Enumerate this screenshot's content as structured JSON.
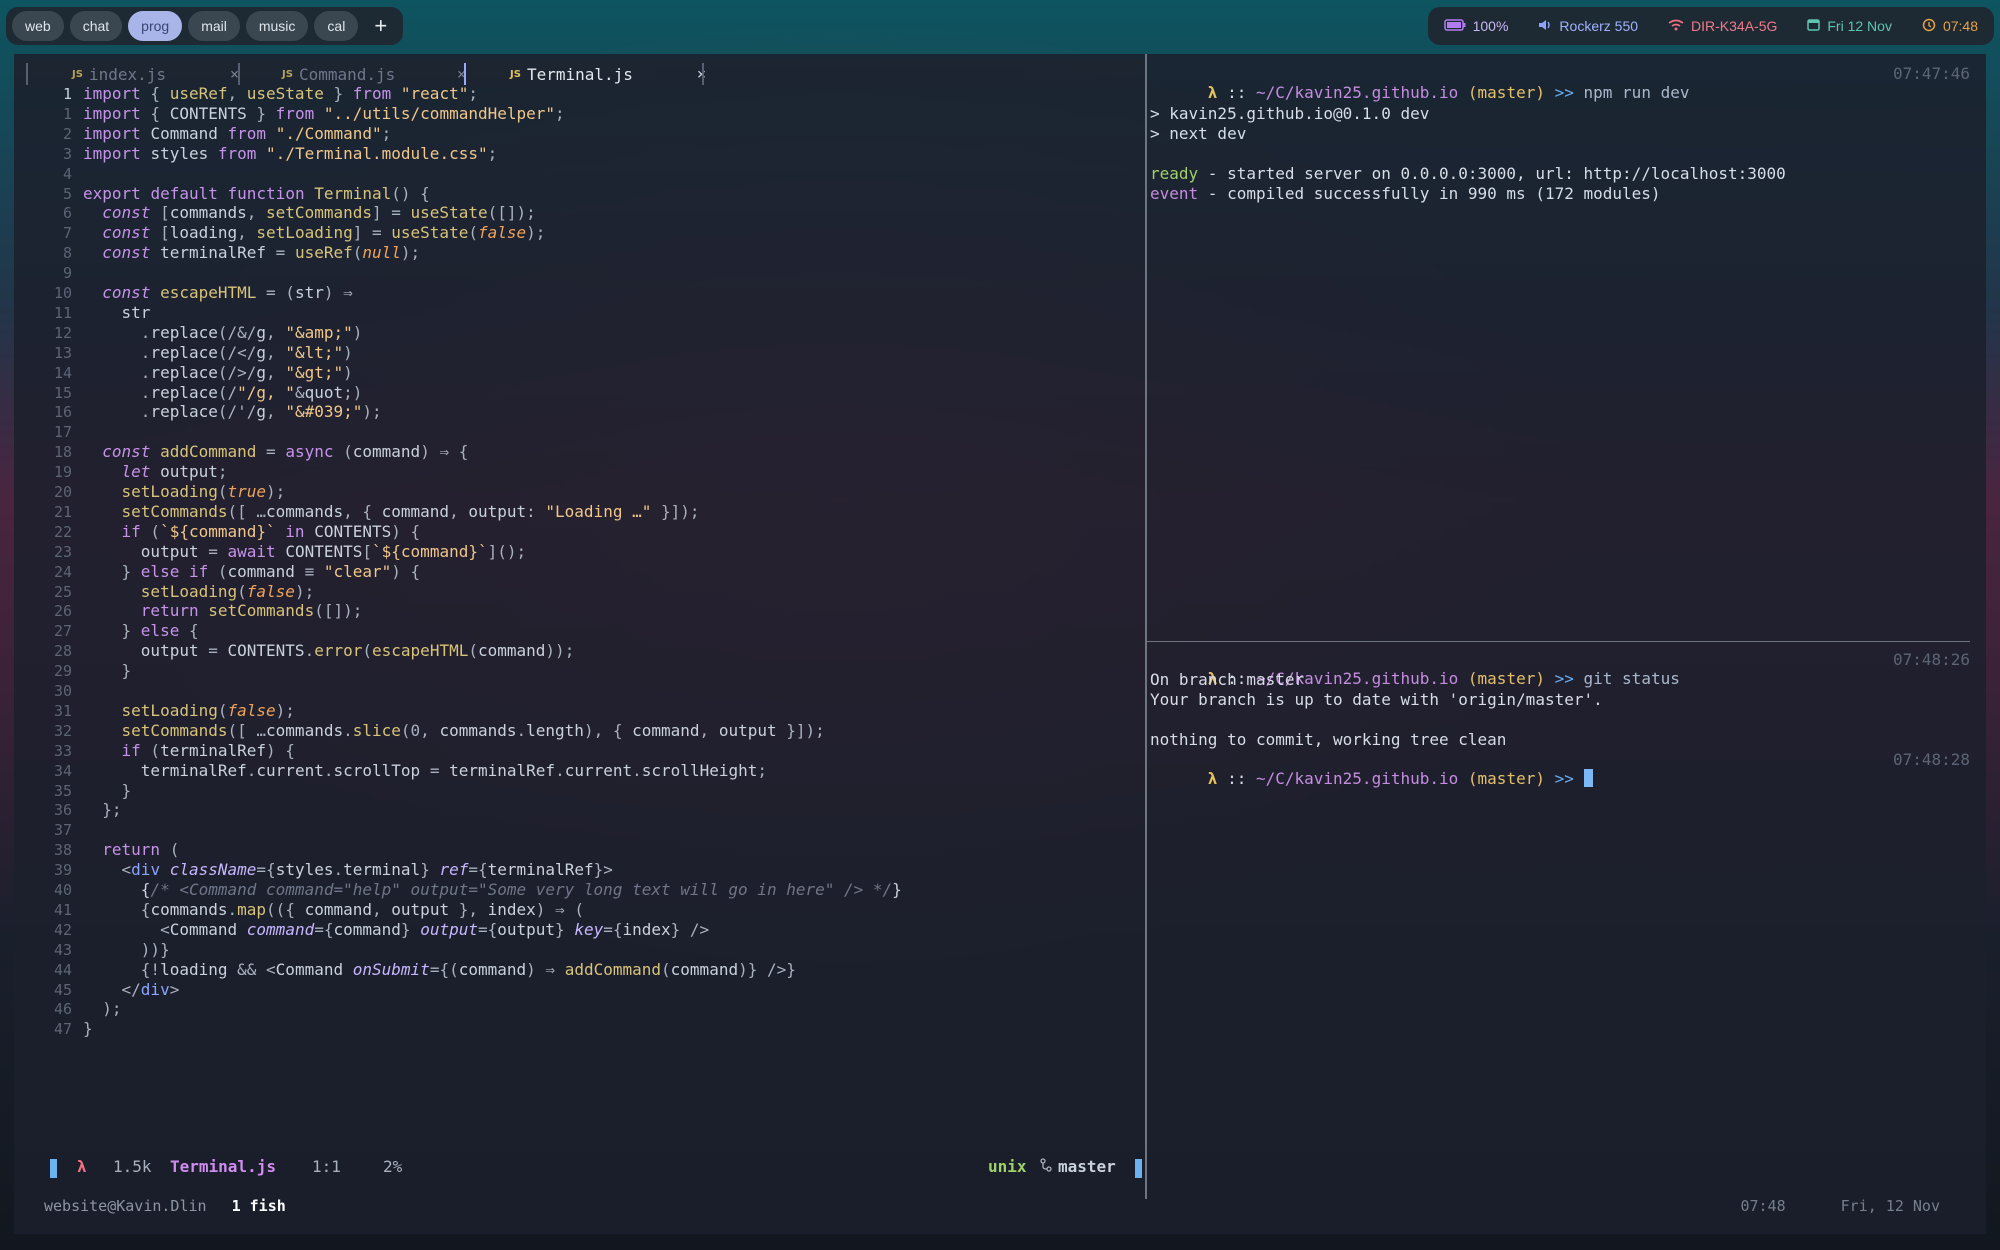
{
  "workspaces": [
    "web",
    "chat",
    "prog",
    "mail",
    "music",
    "cal"
  ],
  "workspace_add": "+",
  "status": {
    "battery": "100%",
    "audio": "Rockerz 550",
    "wifi": "DIR-K34A-5G",
    "date": "Fri 12 Nov",
    "time": "07:48"
  },
  "colors": {
    "accent": "#a9b4e8",
    "battery": "#b07cf0",
    "audio": "#8aa4ff",
    "wifi": "#f07080",
    "date": "#5fc4b0",
    "time": "#e6a24a"
  },
  "tabs": [
    {
      "icon": "JS",
      "name": "index.js",
      "close": "×"
    },
    {
      "icon": "JS",
      "name": "Command.js",
      "close": "×"
    },
    {
      "icon": "JS",
      "name": "Terminal.js",
      "close": "×"
    }
  ],
  "editor_lines": [
    {
      "n": "1",
      "t": "import { useRef, useState } from \"react\";"
    },
    {
      "n": "1",
      "t": "import { CONTENTS } from \"../utils/commandHelper\";"
    },
    {
      "n": "2",
      "t": "import Command from \"./Command\";"
    },
    {
      "n": "3",
      "t": "import styles from \"./Terminal.module.css\";"
    },
    {
      "n": "4",
      "t": ""
    },
    {
      "n": "5",
      "t": "export default function Terminal() {"
    },
    {
      "n": "6",
      "t": "  const [commands, setCommands] = useState([]);"
    },
    {
      "n": "7",
      "t": "  const [loading, setLoading] = useState(false);"
    },
    {
      "n": "8",
      "t": "  const terminalRef = useRef(null);"
    },
    {
      "n": "9",
      "t": ""
    },
    {
      "n": "10",
      "t": "  const escapeHTML = (str) ⇒"
    },
    {
      "n": "11",
      "t": "    str"
    },
    {
      "n": "12",
      "t": "      .replace(/&/g, \"&amp;\")"
    },
    {
      "n": "13",
      "t": "      .replace(/</g, \"&lt;\")"
    },
    {
      "n": "14",
      "t": "      .replace(/>/g, \"&gt;\")"
    },
    {
      "n": "15",
      "t": "      .replace(/\"/g, \"&quot;\")"
    },
    {
      "n": "16",
      "t": "      .replace(/'/g, \"&#039;\");"
    },
    {
      "n": "17",
      "t": ""
    },
    {
      "n": "18",
      "t": "  const addCommand = async (command) ⇒ {"
    },
    {
      "n": "19",
      "t": "    let output;"
    },
    {
      "n": "20",
      "t": "    setLoading(true);"
    },
    {
      "n": "21",
      "t": "    setCommands([ …commands, { command, output: \"Loading …\" }]);"
    },
    {
      "n": "22",
      "t": "    if (`${command}` in CONTENTS) {"
    },
    {
      "n": "23",
      "t": "      output = await CONTENTS[`${command}`]();"
    },
    {
      "n": "24",
      "t": "    } else if (command ≡ \"clear\") {"
    },
    {
      "n": "25",
      "t": "      setLoading(false);"
    },
    {
      "n": "26",
      "t": "      return setCommands([]);"
    },
    {
      "n": "27",
      "t": "    } else {"
    },
    {
      "n": "28",
      "t": "      output = CONTENTS.error(escapeHTML(command));"
    },
    {
      "n": "29",
      "t": "    }"
    },
    {
      "n": "30",
      "t": ""
    },
    {
      "n": "31",
      "t": "    setLoading(false);"
    },
    {
      "n": "32",
      "t": "    setCommands([ …commands.slice(0, commands.length), { command, output }]);"
    },
    {
      "n": "33",
      "t": "    if (terminalRef) {"
    },
    {
      "n": "34",
      "t": "      terminalRef.current.scrollTop = terminalRef.current.scrollHeight;"
    },
    {
      "n": "35",
      "t": "    }"
    },
    {
      "n": "36",
      "t": "  };"
    },
    {
      "n": "37",
      "t": ""
    },
    {
      "n": "38",
      "t": "  return ("
    },
    {
      "n": "39",
      "t": "    <div className={styles.terminal} ref={terminalRef}>"
    },
    {
      "n": "40",
      "t": "      {/* <Command command=\"help\" output=\"Some very long text will go in here\" /> */}"
    },
    {
      "n": "41",
      "t": "      {commands.map(({ command, output }, index) ⇒ ("
    },
    {
      "n": "42",
      "t": "        <Command command={command} output={output} key={index} />"
    },
    {
      "n": "43",
      "t": "      ))}"
    },
    {
      "n": "44",
      "t": "      {!loading && <Command onSubmit={(command) ⇒ addCommand(command)} />}"
    },
    {
      "n": "45",
      "t": "    </div>"
    },
    {
      "n": "46",
      "t": "  );"
    },
    {
      "n": "47",
      "t": "}"
    }
  ],
  "statusline": {
    "mode": "λ",
    "size": "1.5k",
    "file": "Terminal.js",
    "pos": "1:1",
    "pct": "2%",
    "format": "unix",
    "branch": "master"
  },
  "tmux": {
    "session": "website@Kavin.Dlin",
    "window": "1 fish",
    "time": "07:48",
    "date": "Fri, 12 Nov"
  },
  "pane_top": {
    "prompt": {
      "lambda": "λ",
      "sep": " :: ",
      "path": "~/C/kavin25.github.io",
      "branch": "(master)",
      "arrow": ">>",
      "cmd": "npm run dev",
      "ts": "07:47:46"
    },
    "out1": "> kavin25.github.io@0.1.0 dev",
    "out2": "> next dev",
    "ready_label": "ready",
    "ready_text": " - started server on 0.0.0.0:3000, url: http://localhost:3000",
    "event_label": "event",
    "event_text": " - compiled successfully in 990 ms (172 modules)"
  },
  "pane_bottom": {
    "prompt1": {
      "lambda": "λ",
      "sep": " :: ",
      "path": "~/C/kavin25.github.io",
      "branch": "(master)",
      "arrow": ">>",
      "cmd": "git status",
      "ts": "07:48:26"
    },
    "out1": "On branch master",
    "out2": "Your branch is up to date with 'origin/master'.",
    "out3": "nothing to commit, working tree clean",
    "prompt2": {
      "lambda": "λ",
      "sep": " :: ",
      "path": "~/C/kavin25.github.io",
      "branch": "(master)",
      "arrow": ">>",
      "ts": "07:48:28"
    }
  }
}
